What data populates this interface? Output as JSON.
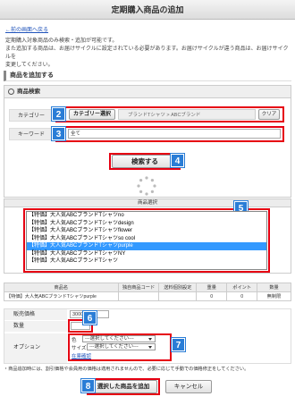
{
  "title": "定期購入商品の追加",
  "back_link": "←前の画面へ戻る",
  "notes": [
    "定期購入対象商品のみ検索・追加が可能です。",
    "また追加する商品は、お届けサイクルに設定されている必要があります。お届けサイクルが違う商品は、お届けサイクルを",
    "変更してください。"
  ],
  "section_title": "商品を追加する",
  "search_panel": {
    "heading": "商品検索",
    "category_label": "カテゴリー",
    "category_button": "カテゴリー選択",
    "category_value": "ブランドTシャツ > ABCブランド",
    "clear_button": "クリア",
    "keyword_label": "キーワード",
    "keyword_value": "全て",
    "search_button": "検索する"
  },
  "badges": [
    "2",
    "3",
    "4",
    "5",
    "6",
    "7",
    "8"
  ],
  "product_select": {
    "heading": "商品選択",
    "items": [
      "【特価】大人気ABCブランドTシャツno",
      "【特価】大人気ABCブランドTシャツdesign",
      "【特価】大人気ABCブランドTシャツflower",
      "【特価】大人気ABCブランドTシャツso cool",
      "【特価】大人気ABCブランドTシャツpurple",
      "【特価】大人気ABCブランドTシャツNY",
      "【特価】大人気ABCブランドTシャツ"
    ],
    "selected_index": 4
  },
  "product_table": {
    "headers": [
      "商品名",
      "独自商品コード",
      "送料個別設定",
      "重量",
      "ポイント",
      "数量"
    ],
    "row": [
      "【特価】大人気ABCブランドTシャツpurple",
      "",
      "",
      "0",
      "0",
      "無制限"
    ]
  },
  "form": {
    "price_label": "販売価格",
    "price_value": "3000",
    "qty_label": "数量",
    "qty_value": "",
    "option_label": "オプション",
    "option_color_label": "色",
    "option_color_value": "---選択してください---",
    "option_size_label": "サイズ",
    "option_size_value": "---選択してください---",
    "stock_link": "在庫確認"
  },
  "footer_note": "・商品追加時には、割引価格や会員用の価格は適用されませんので、必要に応じて手動での価格修正をしてください。",
  "buttons": {
    "add": "選択した商品を追加",
    "cancel": "キャンセル"
  },
  "colors": {
    "highlight_red": "#e60012",
    "badge_blue": "#2a7dd6",
    "selection_blue": "#3399ff"
  }
}
